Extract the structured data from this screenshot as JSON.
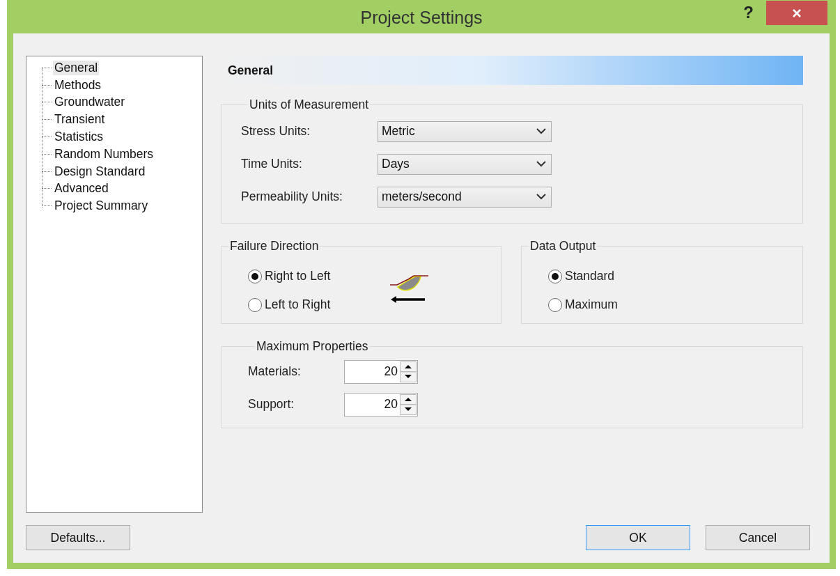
{
  "window": {
    "title": "Project Settings",
    "help_button": "?"
  },
  "sidebar": {
    "items": [
      {
        "label": "General",
        "selected": true
      },
      {
        "label": "Methods",
        "selected": false
      },
      {
        "label": "Groundwater",
        "selected": false
      },
      {
        "label": "Transient",
        "selected": false
      },
      {
        "label": "Statistics",
        "selected": false
      },
      {
        "label": "Random Numbers",
        "selected": false
      },
      {
        "label": "Design Standard",
        "selected": false
      },
      {
        "label": "Advanced",
        "selected": false
      },
      {
        "label": "Project Summary",
        "selected": false
      }
    ]
  },
  "page_header": "General",
  "units_group": {
    "title": "Units of Measurement",
    "fields": [
      {
        "label": "Stress Units:",
        "value": "Metric"
      },
      {
        "label": "Time Units:",
        "value": "Days"
      },
      {
        "label": "Permeability Units:",
        "value": "meters/second"
      }
    ]
  },
  "failure_direction": {
    "title": "Failure Direction",
    "options": [
      {
        "label": "Right to Left",
        "selected": true
      },
      {
        "label": "Left to Right",
        "selected": false
      }
    ]
  },
  "data_output": {
    "title": "Data Output",
    "options": [
      {
        "label": "Standard",
        "selected": true
      },
      {
        "label": "Maximum",
        "selected": false
      }
    ]
  },
  "maximum_properties": {
    "title": "Maximum Properties",
    "fields": [
      {
        "label": "Materials:",
        "value": "20"
      },
      {
        "label": "Support:",
        "value": "20"
      }
    ]
  },
  "buttons": {
    "defaults": "Defaults...",
    "ok": "OK",
    "cancel": "Cancel"
  }
}
